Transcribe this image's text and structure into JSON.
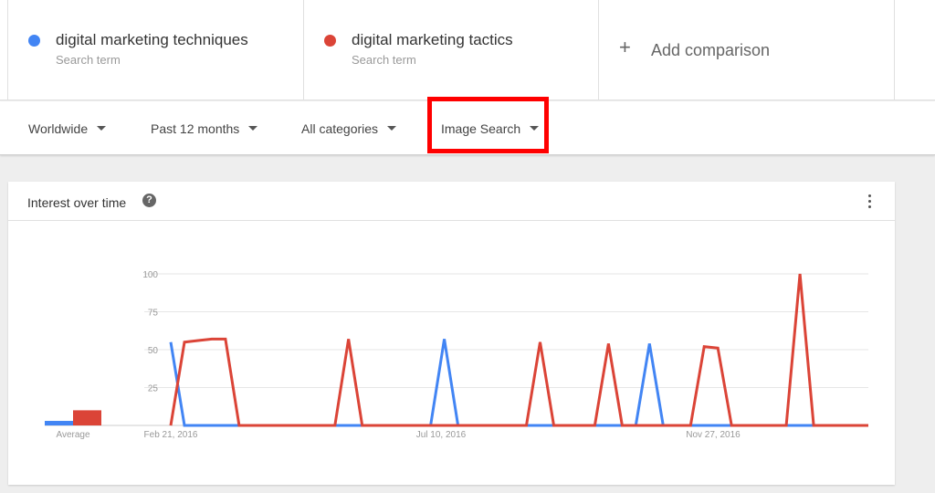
{
  "terms": [
    {
      "name": "digital marketing techniques",
      "sub": "Search term",
      "color": "#4285f4"
    },
    {
      "name": "digital marketing tactics",
      "sub": "Search term",
      "color": "#db4437"
    }
  ],
  "add_comparison": {
    "plus": "+",
    "label": "Add comparison"
  },
  "filters": {
    "region": "Worldwide",
    "time": "Past 12 months",
    "category": "All categories",
    "search_type": "Image Search"
  },
  "card": {
    "title": "Interest over time",
    "help": "?"
  },
  "chart_data": {
    "type": "line",
    "title": "Interest over time",
    "ylim": [
      0,
      100
    ],
    "yticks": [
      "100",
      "75",
      "50",
      "25"
    ],
    "xtick_labels": [
      "Feb 21, 2016",
      "Jul 10, 2016",
      "Nov 27, 2016"
    ],
    "average_label": "Average",
    "averages": [
      {
        "name": "digital marketing techniques",
        "value": 3,
        "color": "#4285f4"
      },
      {
        "name": "digital marketing tactics",
        "value": 10,
        "color": "#db4437"
      }
    ],
    "series": [
      {
        "name": "digital marketing techniques",
        "color": "#4285f4",
        "values": [
          55,
          0,
          0,
          0,
          0,
          0,
          0,
          0,
          0,
          0,
          0,
          0,
          0,
          0,
          0,
          0,
          0,
          0,
          0,
          0,
          57,
          0,
          0,
          0,
          0,
          0,
          0,
          0,
          0,
          0,
          0,
          0,
          0,
          0,
          0,
          54,
          0,
          0,
          0,
          0,
          0,
          0,
          0,
          0,
          0,
          0,
          0,
          0,
          0,
          0,
          0,
          0
        ]
      },
      {
        "name": "digital marketing tactics",
        "color": "#db4437",
        "values": [
          0,
          55,
          56,
          57,
          57,
          0,
          0,
          0,
          0,
          0,
          0,
          0,
          0,
          57,
          0,
          0,
          0,
          0,
          0,
          0,
          0,
          0,
          0,
          0,
          0,
          0,
          0,
          55,
          0,
          0,
          0,
          0,
          54,
          0,
          0,
          0,
          0,
          0,
          0,
          52,
          51,
          0,
          0,
          0,
          0,
          0,
          100,
          0,
          0,
          0,
          0,
          0
        ]
      }
    ]
  }
}
